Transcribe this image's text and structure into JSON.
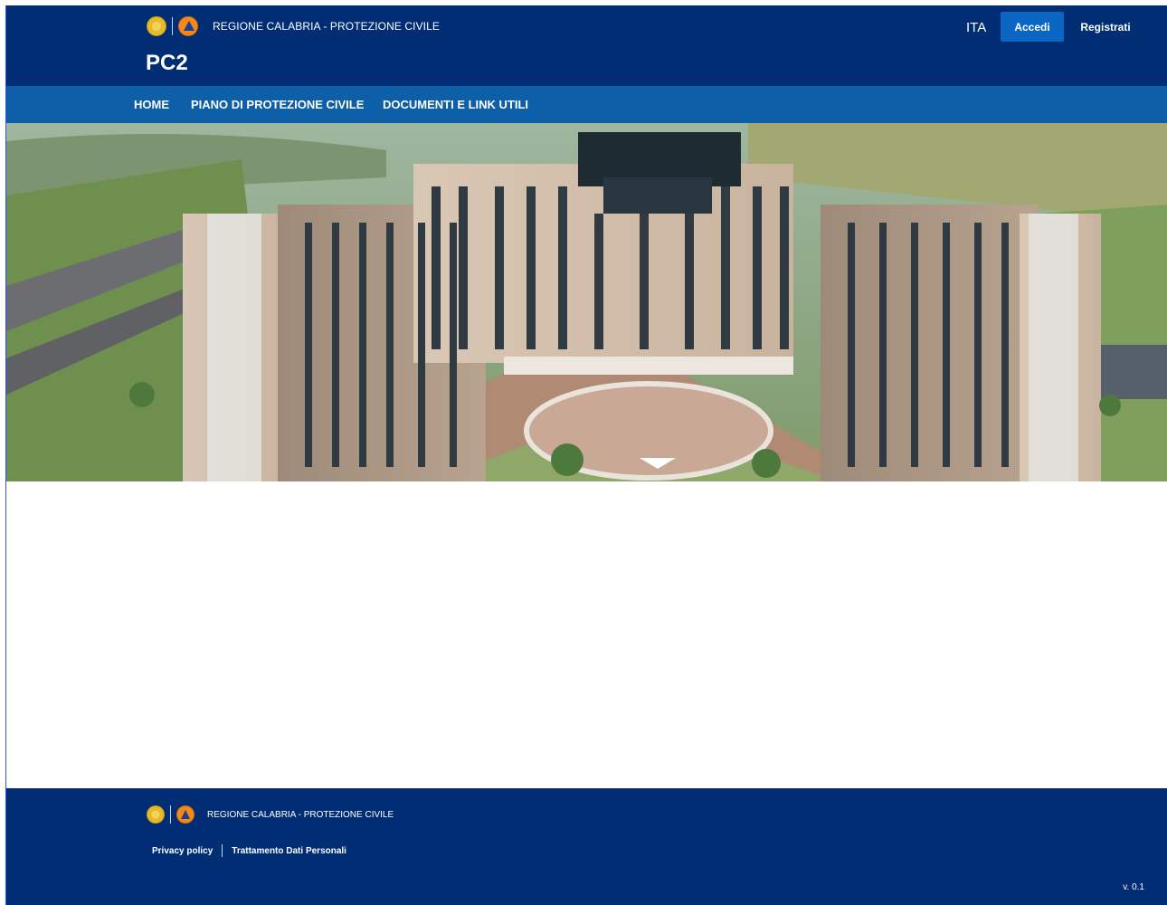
{
  "header": {
    "brand_text": "REGIONE CALABRIA - PROTEZIONE CIVILE",
    "app_title": "PC2",
    "language": "ITA",
    "login_label": "Accedi",
    "register_label": "Registrati"
  },
  "nav": {
    "items": [
      {
        "label": "HOME"
      },
      {
        "label": "PIANO DI PROTEZIONE CIVILE"
      },
      {
        "label": "DOCUMENTI E LINK UTILI"
      }
    ]
  },
  "footer": {
    "brand_text": "REGIONE CALABRIA - PROTEZIONE CIVILE",
    "links": [
      {
        "label": "Privacy policy"
      },
      {
        "label": "Trattamento Dati Personali"
      }
    ],
    "version": "v. 0.1"
  },
  "colors": {
    "header_bg": "#002d74",
    "nav_bg": "#0d5fa8",
    "login_button": "#0a66c2"
  },
  "icons": [
    "region-crest-icon",
    "civil-protection-logo-icon"
  ]
}
